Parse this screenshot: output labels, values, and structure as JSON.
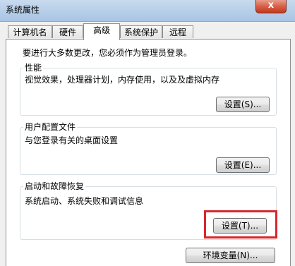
{
  "window": {
    "title": "系统属性",
    "close_glyph": "x"
  },
  "tabs": [
    {
      "label": "计算机名"
    },
    {
      "label": "硬件"
    },
    {
      "label": "高级"
    },
    {
      "label": "系统保护"
    },
    {
      "label": "远程"
    }
  ],
  "active_tab": "高级",
  "notice": "要进行大多数更改，您必须作为管理员登录。",
  "performance": {
    "title": "性能",
    "description": "视觉效果，处理器计划，内存使用，以及及虚拟内存",
    "button_label": "设置(S)..."
  },
  "user_profiles": {
    "title": "用户配置文件",
    "description": "与您登录有关的桌面设置",
    "button_label": "设置(E)..."
  },
  "startup_recovery": {
    "title": "启动和故障恢复",
    "description": "系统启动、系统失败和调试信息",
    "button_label": "设置(T)..."
  },
  "env_button_label": "环境变量(N)...",
  "colors": {
    "highlight": "#d8262c"
  }
}
